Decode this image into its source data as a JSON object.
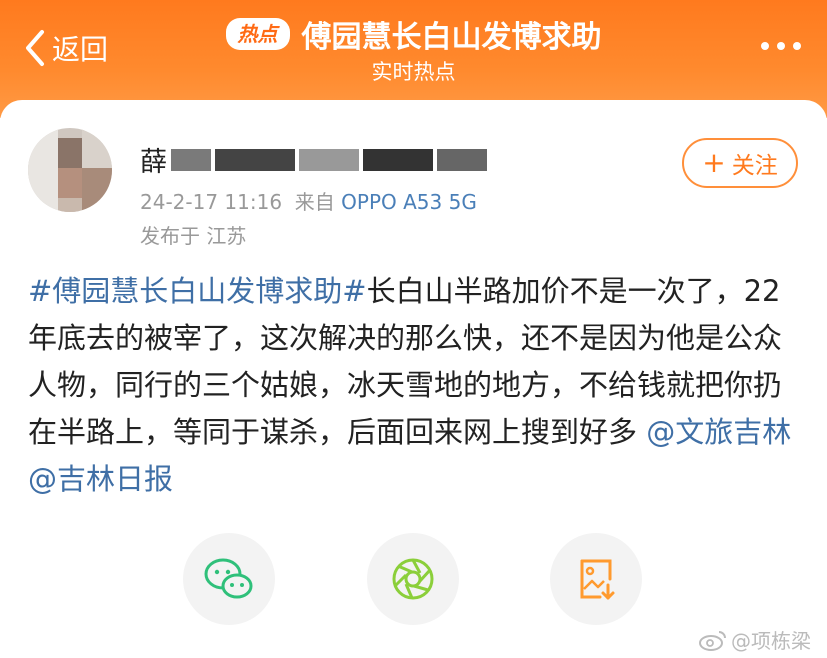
{
  "header": {
    "back_label": "返回",
    "badge": "热点",
    "title": "傅园慧长白山发博求助",
    "subtitle": "实时热点"
  },
  "post": {
    "username_visible": "薛",
    "timestamp": "24-2-17 11:16",
    "source_prefix": "来自",
    "device": "OPPO A53 5G",
    "location_prefix": "发布于",
    "location": "江苏",
    "follow_label": "关注",
    "hashtag": "#傅园慧长白山发博求助#",
    "body": "长白山半路加价不是一次了，22年底去的被宰了，这次解决的那么快，还不是因为他是公众人物，同行的三个姑娘，冰天雪地的地方，不给钱就把你扔在半路上，等同于谋杀，后面回来网上搜到好多",
    "mention1": "@文旅吉林",
    "mention2": "@吉林日报"
  },
  "share": [
    "wechat-icon",
    "moments-icon",
    "save-image-icon"
  ],
  "watermark": "@项栋梁",
  "colors": {
    "accent": "#ff7a1e",
    "link": "#3f6fa6",
    "wechat_green": "#2fc07a",
    "moments_green": "#8bcf3a",
    "save_orange": "#ff9a2e"
  }
}
